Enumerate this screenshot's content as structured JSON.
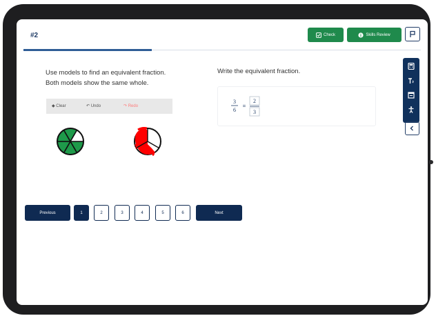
{
  "question": {
    "title": "#2"
  },
  "actions": {
    "check_label": "Check",
    "skills_label": "Skills Review"
  },
  "icons": {
    "flag": "flag-icon",
    "calculator": "calculator-icon",
    "text_to_speech": "text-to-speech-icon",
    "notepad": "notepad-icon",
    "accessibility": "accessibility-icon",
    "collapse": "chevron-left-icon"
  },
  "instructions": {
    "left_line1": "Use models to find an equivalent fraction.",
    "left_line2": "Both models show the same whole.",
    "right": "Write the equivalent fraction."
  },
  "drawing_toolbar": {
    "clear_label": "Clear",
    "undo_label": "Undo",
    "redo_label": "Redo"
  },
  "fraction": {
    "numerator": "3",
    "denominator": "6",
    "answer_numerator": "2",
    "answer_denominator": "3"
  },
  "pagination": {
    "previous_label": "Previous",
    "next_label": "Next",
    "pages": [
      "1",
      "2",
      "3",
      "4",
      "5",
      "6"
    ],
    "current_page": "1"
  },
  "colors": {
    "shade_green": "#1e9a4a",
    "scribble_red": "#ff0000",
    "navy": "#0f2a52",
    "action_green": "#1f8a4c"
  }
}
